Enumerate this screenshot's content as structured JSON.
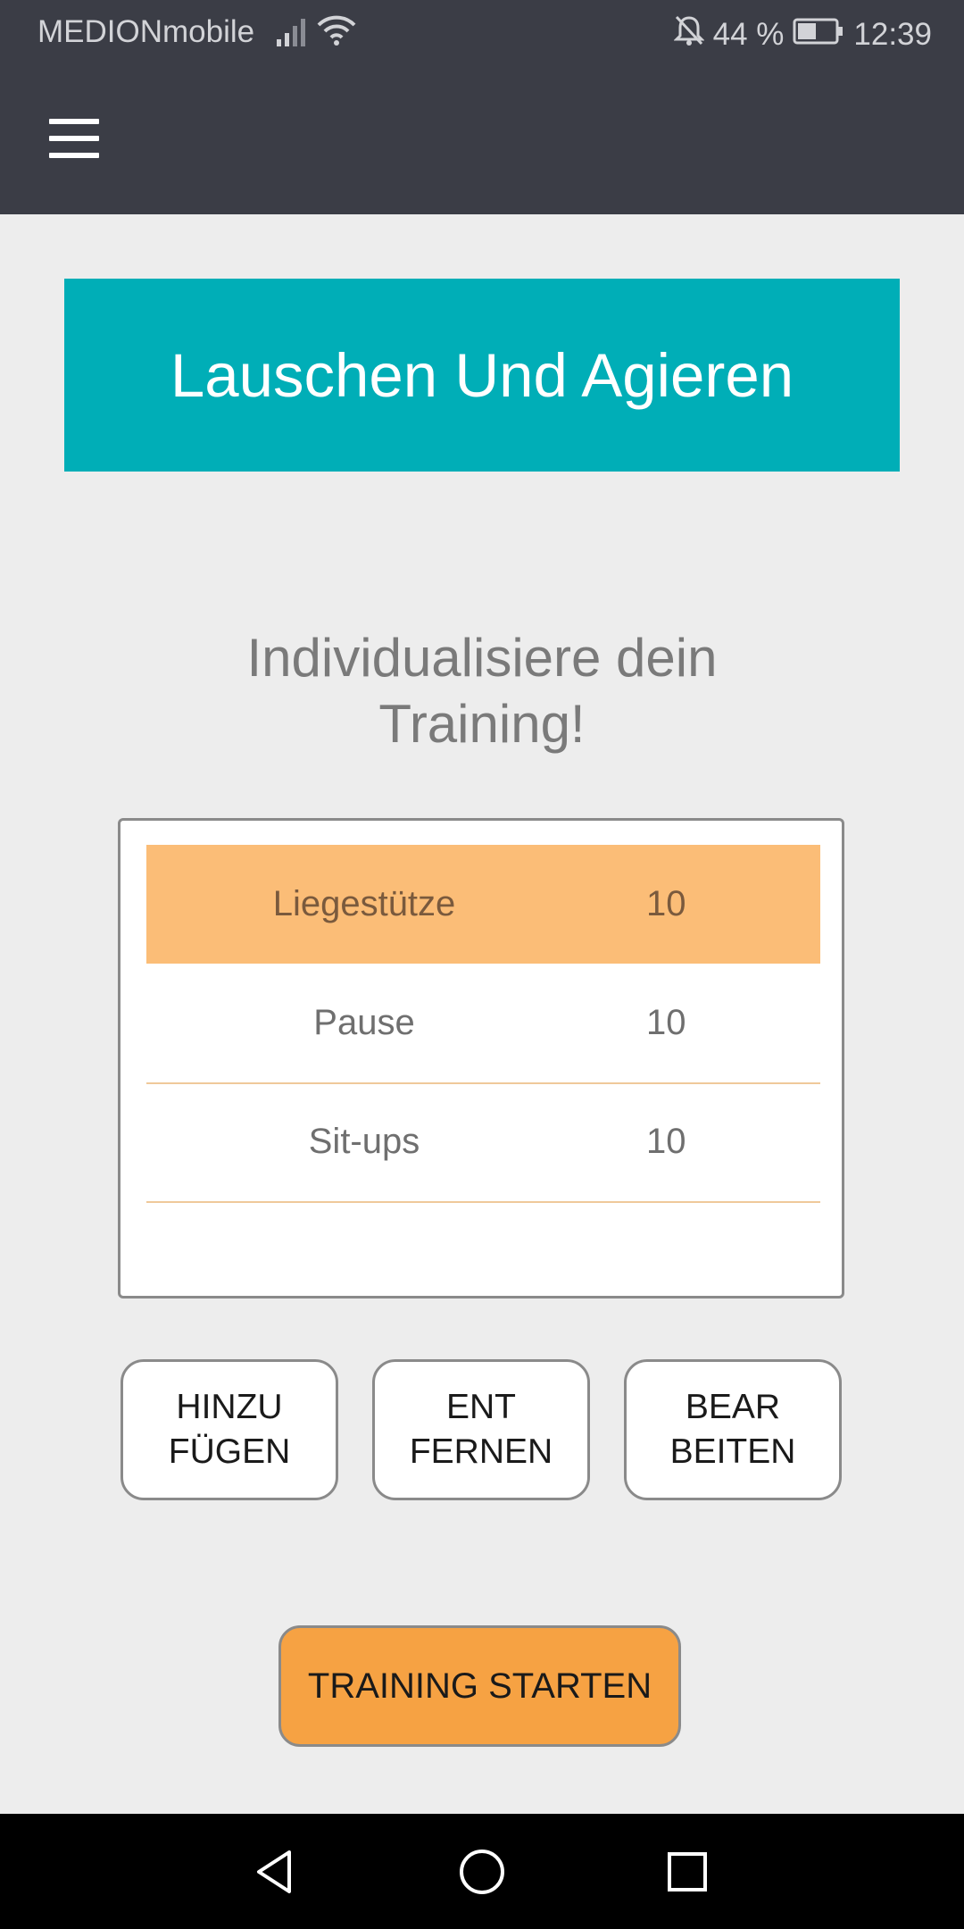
{
  "status_bar": {
    "carrier": "MEDIONmobile",
    "battery": "44 %",
    "time": "12:39",
    "icons": [
      "signal-icon",
      "wifi-icon",
      "notifications-off-icon",
      "battery-icon"
    ]
  },
  "toolbar": {
    "menu_icon": "hamburger-menu-icon"
  },
  "banner": {
    "title": "Lauschen Und Agieren",
    "color": "#00aeb7"
  },
  "heading": {
    "line1": "Individualisiere dein",
    "line2": "Training!"
  },
  "exercise_list": {
    "items": [
      {
        "name": "Liegestütze",
        "value": "10",
        "selected": true
      },
      {
        "name": "Pause",
        "value": "10",
        "selected": false
      },
      {
        "name": "Sit-ups",
        "value": "10",
        "selected": false
      }
    ],
    "selected_color": "#fbbd77"
  },
  "buttons": {
    "add": {
      "line1": "HINZU",
      "line2": "FÜGEN"
    },
    "remove": {
      "line1": "ENT",
      "line2": "FERNEN"
    },
    "edit": {
      "line1": "BEAR",
      "line2": "BEITEN"
    },
    "start": "TRAINING STARTEN",
    "start_color": "#f6a243"
  },
  "nav_bar": {
    "icons": [
      "back-icon",
      "home-icon",
      "recents-icon"
    ]
  }
}
